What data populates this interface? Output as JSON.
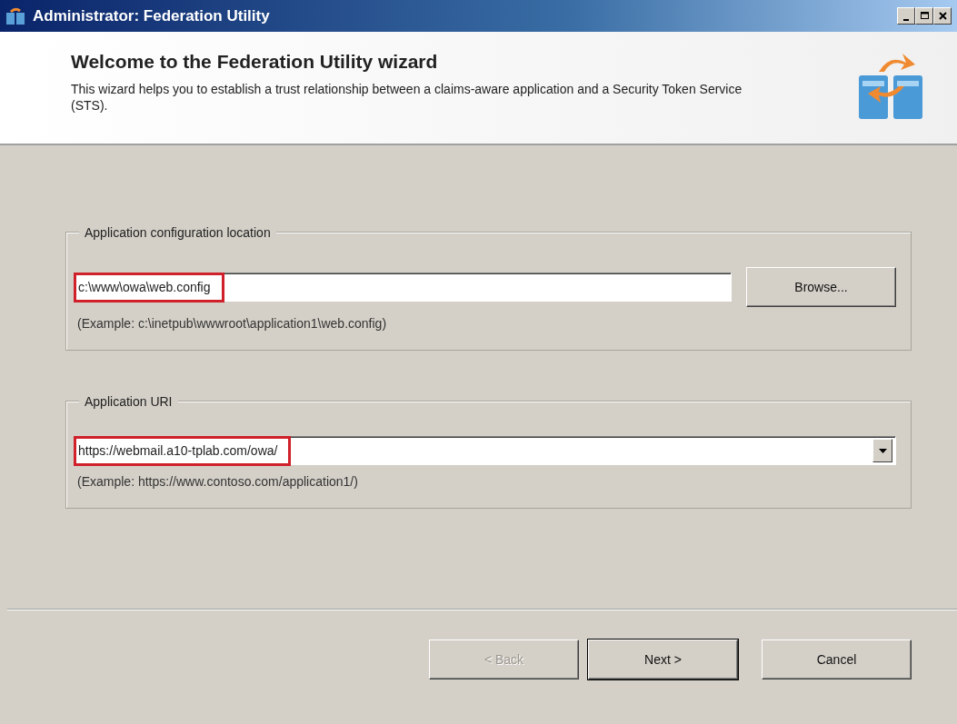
{
  "window": {
    "title": "Administrator: Federation Utility"
  },
  "header": {
    "title": "Welcome to the Federation Utility wizard",
    "description": "This wizard helps you to establish a trust relationship between a claims-aware application and a Security Token Service (STS)."
  },
  "groups": [
    {
      "kind": "text",
      "legend": "Application configuration location",
      "value": "c:\\www\\owa\\web.config",
      "highlighted": true,
      "button": "Browse...",
      "example": "(Example: c:\\inetpub\\wwwroot\\application1\\web.config)"
    },
    {
      "kind": "combo",
      "legend": "Application URI",
      "value": "https://webmail.a10-tplab.com/owa/",
      "highlighted": true,
      "example": "(Example: https://www.contoso.com/application1/)"
    }
  ],
  "buttons": [
    {
      "label": "< Back",
      "disabled": true,
      "default": false
    },
    {
      "label": "Next >",
      "disabled": false,
      "default": true
    },
    {
      "label": "Cancel",
      "disabled": false,
      "default": false
    }
  ]
}
